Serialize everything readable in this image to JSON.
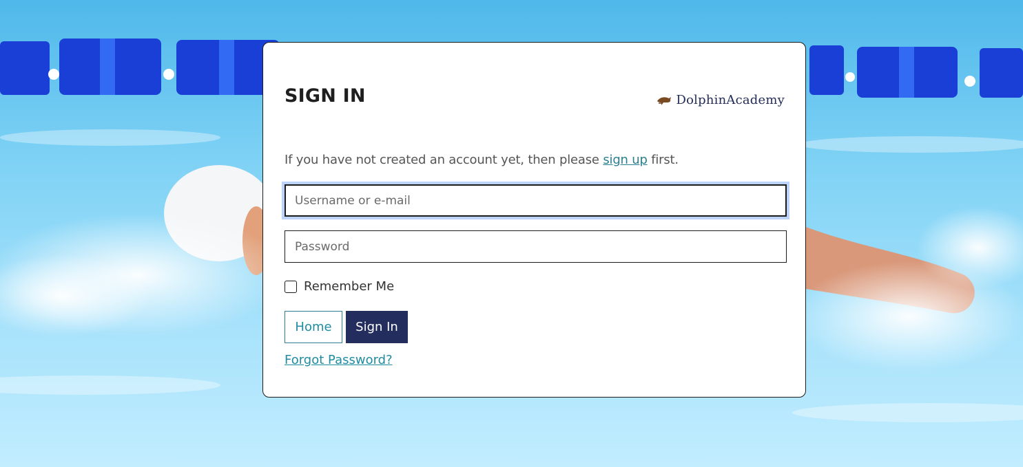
{
  "page": {
    "title": "SIGN IN",
    "brand": {
      "name": "DolphinAcademy",
      "logo_icon": "dolphin-logo-icon"
    },
    "intro": {
      "before": "If you have not created an account yet, then please ",
      "link": "sign up",
      "after": " first."
    },
    "form": {
      "username_placeholder": "Username or e-mail",
      "username_value": "",
      "password_placeholder": "Password",
      "password_value": "",
      "remember_label": "Remember Me",
      "remember_checked": false
    },
    "buttons": {
      "home": "Home",
      "sign_in": "Sign In"
    },
    "forgot_password": "Forgot Password?"
  },
  "colors": {
    "primary_navy": "#232d5e",
    "link_teal": "#1f8ca0",
    "focus_ring": "#bcd3fb",
    "pool_water": "#7fd2f5"
  }
}
